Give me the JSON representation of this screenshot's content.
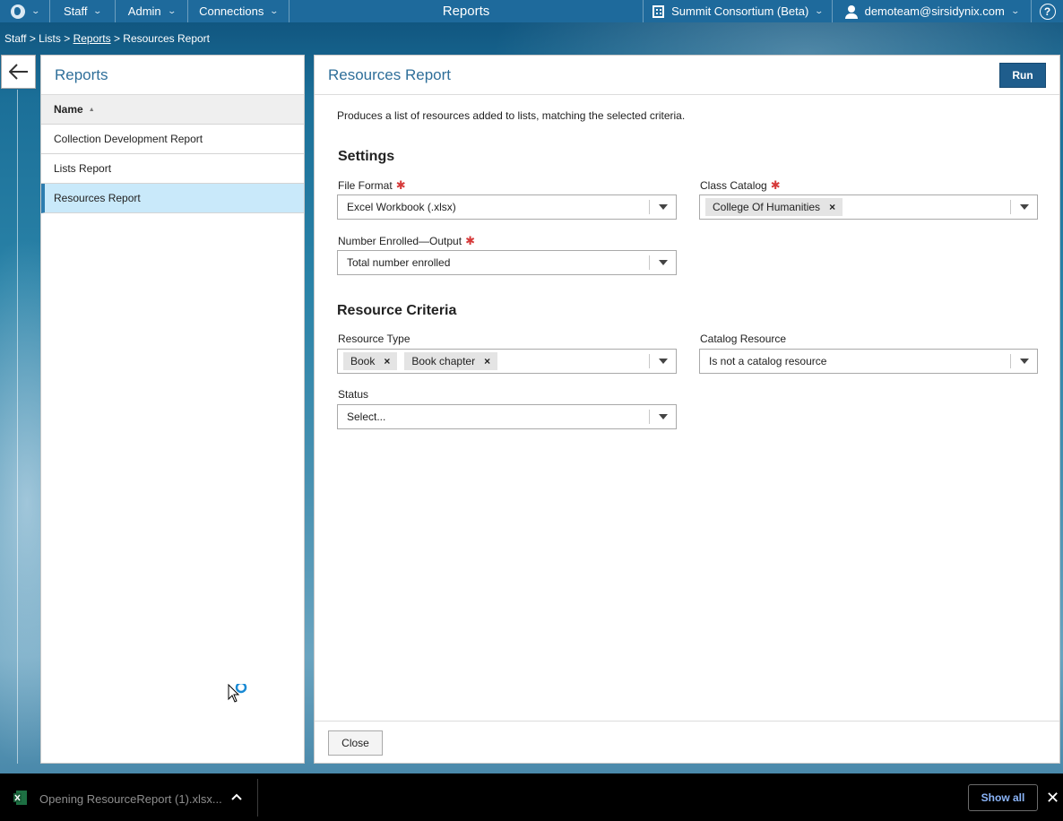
{
  "topbar": {
    "menus": [
      {
        "label": "Staff"
      },
      {
        "label": "Admin"
      },
      {
        "label": "Connections"
      }
    ],
    "center_title": "Reports",
    "consortium": "Summit Consortium (Beta)",
    "user": "demoteam@sirsidynix.com"
  },
  "breadcrumb": {
    "staff": "Staff",
    "lists": "Lists",
    "reports": "Reports",
    "current": "Resources Report",
    "sep": ">"
  },
  "reports_panel": {
    "title": "Reports",
    "column_header": "Name",
    "items": [
      {
        "label": "Collection Development Report"
      },
      {
        "label": "Lists Report"
      },
      {
        "label": "Resources Report",
        "selected": true
      }
    ]
  },
  "main": {
    "title": "Resources Report",
    "run_label": "Run",
    "description": "Produces a list of resources added to lists, matching the selected criteria.",
    "settings": {
      "heading": "Settings",
      "file_format": {
        "label": "File Format",
        "value": "Excel Workbook (.xlsx)"
      },
      "class_catalog": {
        "label": "Class Catalog",
        "chip": "College Of Humanities"
      },
      "number_enrolled": {
        "label": "Number Enrolled—Output",
        "value": "Total number enrolled"
      }
    },
    "criteria": {
      "heading": "Resource Criteria",
      "resource_type": {
        "label": "Resource Type",
        "chips": [
          "Book",
          "Book chapter"
        ]
      },
      "catalog_resource": {
        "label": "Catalog Resource",
        "value": "Is not a catalog resource"
      },
      "status": {
        "label": "Status",
        "placeholder": "Select..."
      }
    },
    "close_label": "Close"
  },
  "download_bar": {
    "file_text": "Opening ResourceReport (1).xlsx...",
    "show_all": "Show all"
  },
  "colors": {
    "nav_bg": "#1e6a9c",
    "primary_button": "#1f5d8c",
    "title_blue": "#2f6f9a",
    "selected_row": "#c9e9fa",
    "required": "#d63a3a"
  }
}
